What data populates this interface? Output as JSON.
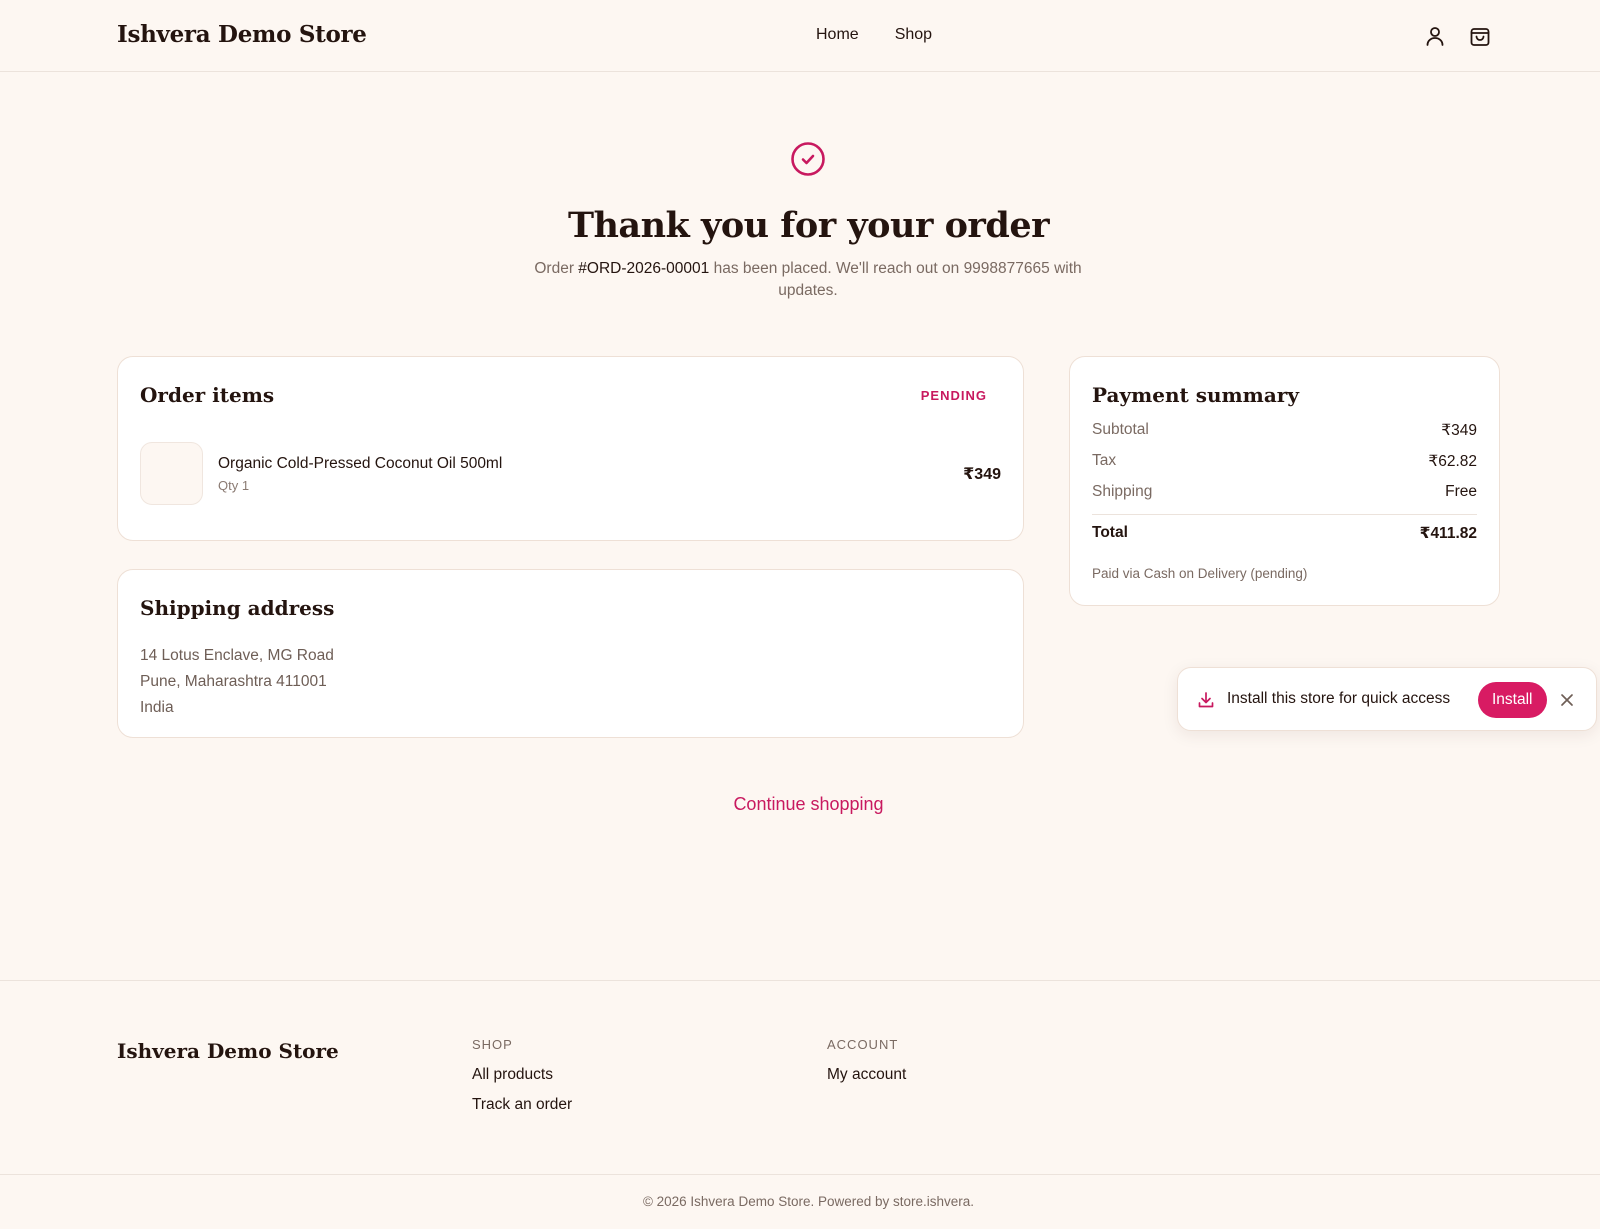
{
  "header": {
    "brand": "Ishvera Demo Store",
    "nav": [
      "Home",
      "Shop"
    ],
    "icons": [
      "user-icon",
      "shopping-bag-icon"
    ]
  },
  "hero": {
    "title": "Thank you for your order",
    "subtitle_prefix": "Order ",
    "order_id": "#ORD-2026-00001",
    "subtitle_suffix": " has been placed. We'll reach out on 9998877665 with updates."
  },
  "order_items": {
    "title": "Order items",
    "status": "PENDING",
    "items": [
      {
        "name": "Organic Cold-Pressed Coconut Oil 500ml",
        "qty": "Qty 1",
        "price": "₹349"
      }
    ]
  },
  "shipping": {
    "title": "Shipping address",
    "lines": [
      "14 Lotus Enclave, MG Road",
      "Pune, Maharashtra 411001",
      "India"
    ]
  },
  "payment": {
    "title": "Payment summary",
    "rows": [
      {
        "label": "Subtotal",
        "value": "₹349"
      },
      {
        "label": "Tax",
        "value": "₹62.82"
      },
      {
        "label": "Shipping",
        "value": "Free"
      }
    ],
    "total_label": "Total",
    "total_value": "₹411.82",
    "note": "Paid via Cash on Delivery (pending)"
  },
  "install_toast": {
    "message": "Install this store for quick access",
    "button": "Install"
  },
  "continue_link": "Continue shopping",
  "footer": {
    "brand": "Ishvera Demo Store",
    "shop_heading": "SHOP",
    "shop_links": [
      "All products",
      "Track an order"
    ],
    "account_heading": "ACCOUNT",
    "account_links": [
      "My account"
    ],
    "copyright": "© 2026 Ishvera Demo Store. Powered by store.ishvera."
  },
  "colors": {
    "background": "#fdf7f2",
    "accent": "#d81b63",
    "text": "#24140f",
    "muted": "#7a6a62"
  }
}
